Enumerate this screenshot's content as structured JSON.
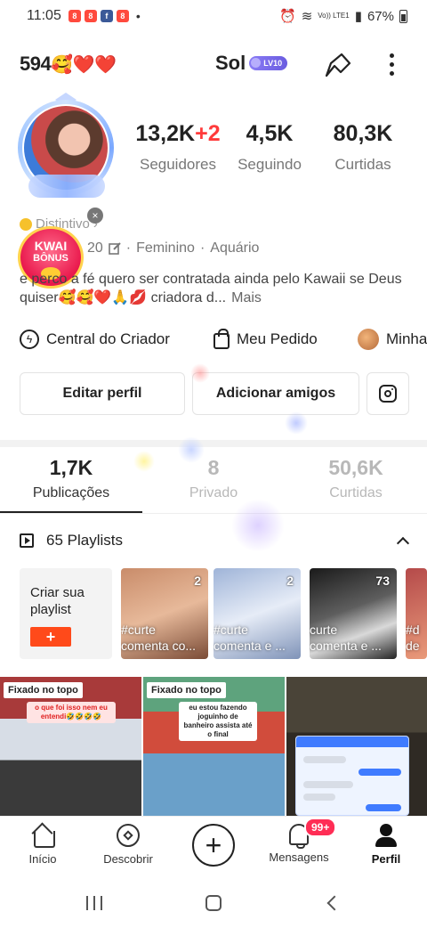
{
  "status_bar": {
    "time": "11:05",
    "network": "Vo)) LTE1",
    "battery": "67%"
  },
  "top_bar": {
    "handle": "594",
    "handle_emoji": "🥰❤️❤️",
    "username": "Sol",
    "level_badge": "LV10"
  },
  "stats": {
    "followers_value": "13,2K",
    "followers_delta": "+2",
    "followers_label": "Seguidores",
    "following_value": "4,5K",
    "following_label": "Seguindo",
    "likes_value": "80,3K",
    "likes_label": "Curtidas"
  },
  "distintivo": {
    "label": "Distintivo",
    "chevron": "›"
  },
  "kwai_bonus": {
    "line1": "KWAI",
    "line2": "BÔNUS",
    "close": "×"
  },
  "profile_meta": {
    "age_suffix": "20",
    "gender": "Feminino",
    "sign": "Aquário",
    "separator": "·"
  },
  "bio": {
    "text": "e perco a fé quero ser contratada ainda pelo Kawaii se Deus quiser🥰🥰❤️🙏💋 criadora d...",
    "more_label": "Mais"
  },
  "creator_row": {
    "creator_center": "Central do Criador",
    "my_order": "Meu Pedido",
    "mine": "Minha"
  },
  "actions": {
    "edit_profile": "Editar perfil",
    "add_friends": "Adicionar amigos"
  },
  "tabs": [
    {
      "count": "1,7K",
      "label": "Publicações"
    },
    {
      "count": "8",
      "label": "Privado"
    },
    {
      "count": "50,6K",
      "label": "Curtidas"
    }
  ],
  "playlists": {
    "header": "65 Playlists",
    "create_label": "Criar sua playlist",
    "create_plus": "+",
    "cards": [
      {
        "count": "2",
        "title": "#curte\ncomenta co..."
      },
      {
        "count": "2",
        "title": "#curte\ncomenta e ..."
      },
      {
        "count": "73",
        "title": "curte\ncomenta e ..."
      },
      {
        "count": "",
        "title": "#d\nde"
      }
    ]
  },
  "grid": {
    "pinned_label": "Fixado no topo",
    "cells": [
      {
        "caption": "o que foi isso nem eu entendi🤣🤣🤣🤣"
      },
      {
        "caption": "eu estou fazendo joguinho de banheiro assista até o final"
      },
      {
        "caption": ""
      }
    ]
  },
  "bottom_nav": {
    "home": "Início",
    "discover": "Descobrir",
    "create": "+",
    "messages": "Mensagens",
    "messages_badge": "99+",
    "profile": "Perfil"
  },
  "colors": {
    "accent": "#ff4a1a",
    "badge_red": "#ff2d55",
    "level_purple": "#7a6cf0",
    "followers_delta": "#ff3b3b"
  }
}
